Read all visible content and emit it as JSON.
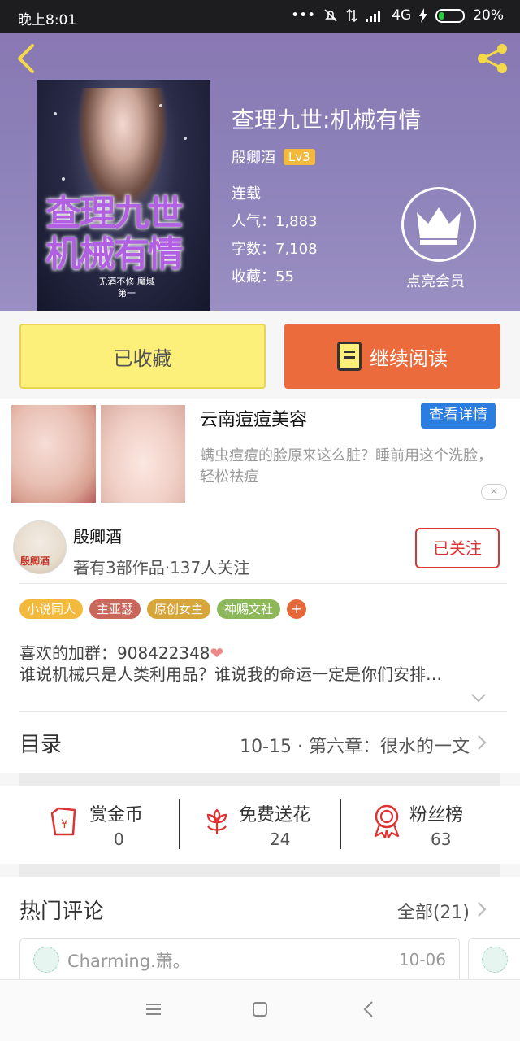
{
  "status_bar": {
    "time": "晚上8:01",
    "network": "4G",
    "battery": "20%"
  },
  "book": {
    "title": "查理九世:机械有情",
    "author": "殷卿酒",
    "level": "Lv3",
    "status": "连载",
    "popularity": "人气：1,883",
    "words": "字数：7,108",
    "favorites": "收藏：55",
    "cover_title": "查理九世 机械有情",
    "cover_sub": "无酒不修 魔域第一"
  },
  "vip": {
    "label": "点亮会员"
  },
  "actions": {
    "favorite_label": "已收藏",
    "read_label": "继续阅读"
  },
  "ad": {
    "title": "云南痘痘美容",
    "button": "查看详情",
    "description": "螨虫痘痘的脸原来这么脏？睡前用这个洗脸，轻松祛痘",
    "close": "×"
  },
  "author": {
    "name": "殷卿酒",
    "info": "著有3部作品·137人关注",
    "follow_label": "已关注",
    "avatar_text": "殷卿酒"
  },
  "tags": [
    {
      "label": "小说同人",
      "color": "#f3b93d"
    },
    {
      "label": "主亚瑟",
      "color": "#c9675a"
    },
    {
      "label": "原创女主",
      "color": "#d7a63a"
    },
    {
      "label": "神赐文社",
      "color": "#8cb85a"
    }
  ],
  "tag_more": "+",
  "intro": {
    "line1": "喜欢的加群：908422348",
    "heart": "❤",
    "line2": "谁说机械只是人类利用品？谁说我的命运一定是你们安排…"
  },
  "toc": {
    "title": "目录",
    "latest": "10-15 · 第六章：很水的一文"
  },
  "stats": [
    {
      "label": "赏金币",
      "value": "0"
    },
    {
      "label": "免费送花",
      "value": "24"
    },
    {
      "label": "粉丝榜",
      "value": "63"
    }
  ],
  "comments": {
    "title": "热门评论",
    "all": "全部(21)",
    "first": {
      "user": "Charming.萧。",
      "date": "10-06"
    }
  },
  "colors": {
    "accent": "#ec6b3d",
    "fav": "#fdf07a",
    "follow": "#dd3333",
    "ad_button": "#2b7de0"
  }
}
